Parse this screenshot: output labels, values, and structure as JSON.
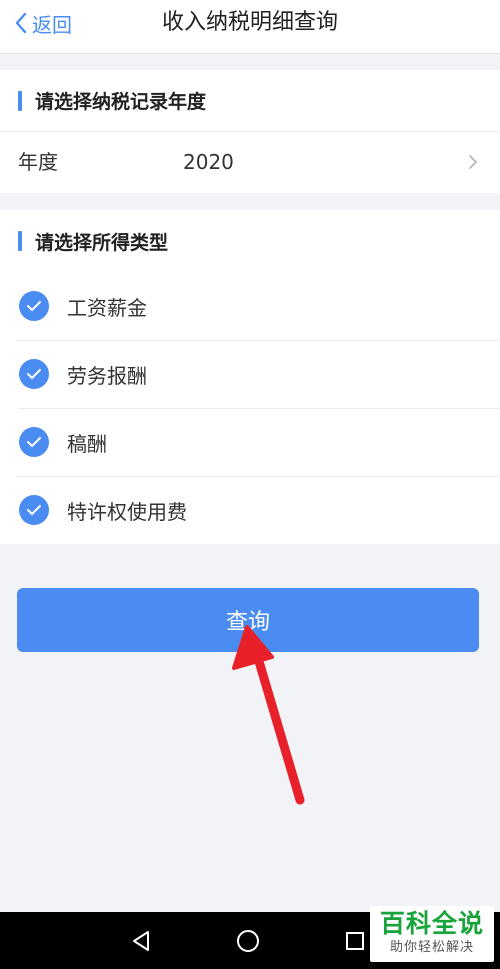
{
  "header": {
    "back_label": "返回",
    "title": "收入纳税明细查询"
  },
  "year_section": {
    "heading": "请选择纳税记录年度",
    "row_label": "年度",
    "row_value": "2020"
  },
  "type_section": {
    "heading": "请选择所得类型",
    "items": [
      {
        "label": "工资薪金",
        "checked": true
      },
      {
        "label": "劳务报酬",
        "checked": true
      },
      {
        "label": "稿酬",
        "checked": true
      },
      {
        "label": "特许权使用费",
        "checked": true
      }
    ]
  },
  "query_button": {
    "label": "查询"
  },
  "watermark": {
    "main": "百科全说",
    "sub": "助你轻松解决"
  },
  "colors": {
    "accent": "#4a8cf1",
    "background": "#f2f3f7",
    "annotation_arrow": "#e8202a",
    "watermark_green": "#18a33b"
  },
  "icons": {
    "back": "chevron-left-icon",
    "row_arrow": "chevron-right-icon",
    "check": "check-circle-icon",
    "nav_back": "triangle-back-icon",
    "nav_home": "circle-home-icon",
    "nav_recent": "square-recent-icon"
  }
}
